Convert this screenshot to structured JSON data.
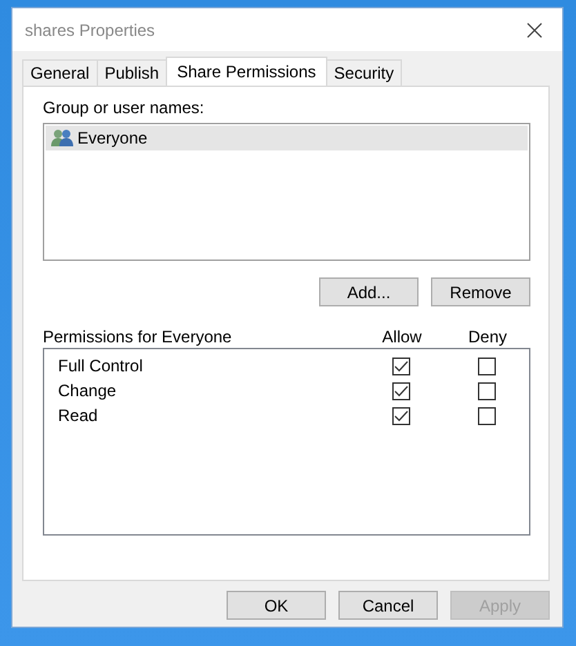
{
  "window": {
    "title": "shares Properties"
  },
  "tabs": [
    {
      "label": "General",
      "selected": false
    },
    {
      "label": "Publish",
      "selected": false
    },
    {
      "label": "Share Permissions",
      "selected": true
    },
    {
      "label": "Security",
      "selected": false
    }
  ],
  "group_list": {
    "label": "Group or user names:",
    "items": [
      {
        "name": "Everyone",
        "selected": true
      }
    ]
  },
  "group_buttons": [
    {
      "label": "Add..."
    },
    {
      "label": "Remove"
    }
  ],
  "permissions": {
    "label": "Permissions for Everyone",
    "columns": [
      "Allow",
      "Deny"
    ],
    "rows": [
      {
        "name": "Full Control",
        "allow": true,
        "deny": false
      },
      {
        "name": "Change",
        "allow": true,
        "deny": false
      },
      {
        "name": "Read",
        "allow": true,
        "deny": false
      }
    ]
  },
  "buttons": [
    {
      "label": "OK",
      "disabled": false
    },
    {
      "label": "Cancel",
      "disabled": false
    },
    {
      "label": "Apply",
      "disabled": true
    }
  ]
}
